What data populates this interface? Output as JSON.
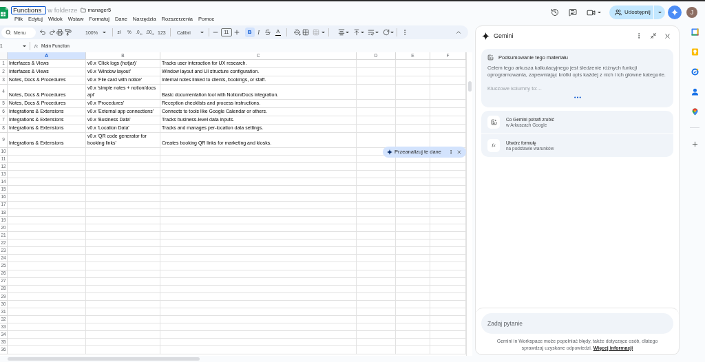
{
  "title_bar": {
    "document_title": "Functions",
    "folder_label": "w folderze",
    "folder_name": "manager5",
    "share_label": "Udostępnij",
    "avatar_initial": "J"
  },
  "menu": [
    "Plik",
    "Edytuj",
    "Widok",
    "Wstaw",
    "Formatuj",
    "Dane",
    "Narzędzia",
    "Rozszerzenia",
    "Pomoc"
  ],
  "toolbar": {
    "search_label": "Menu",
    "zoom": "100%",
    "currency": "zł",
    "percent": "%",
    "decimals_less": ".0",
    "decimals_more": ".00",
    "number_formats": "123",
    "font": "Calibri",
    "font_size": "11",
    "format_buttons": [
      {
        "kind": "bold",
        "label": "B",
        "selected": true
      },
      {
        "kind": "italic",
        "label": "I",
        "selected": false
      },
      {
        "kind": "strikethrough",
        "selected": false
      }
    ],
    "text_color_label": "A"
  },
  "formula_bar": {
    "name_box": "1",
    "function_symbol": "fx",
    "formula": "Main Function"
  },
  "grid": {
    "columns": [
      {
        "label": "A",
        "selected": true
      },
      {
        "label": "B",
        "selected": false
      },
      {
        "label": "C",
        "selected": false
      },
      {
        "label": "D",
        "selected": false
      },
      {
        "label": "E",
        "selected": false
      },
      {
        "label": "F",
        "selected": false
      }
    ],
    "rows": [
      {
        "number": "1",
        "cells": [
          "Interfaces & Views",
          "v0.x 'Click logs (hotjar)'",
          "Tracks user interaction for UX research."
        ]
      },
      {
        "number": "2",
        "cells": [
          "Interfaces & Views",
          "v0.x 'Window layout'",
          "Window layout and UI structure configuration."
        ]
      },
      {
        "number": "3",
        "cells": [
          "Notes, Docs & Procedures",
          "v0.x 'File card with notice'",
          "Internal notes linked to clients, bookings, or staff."
        ]
      },
      {
        "number": "4",
        "cells": [
          "Notes, Docs & Procedures",
          "v0.x 'simple notes + notion/docs api'",
          "Basic documentation tool with Notion/Docs integration."
        ]
      },
      {
        "number": "5",
        "cells": [
          "Notes, Docs & Procedures",
          "v0.x 'Procedures'",
          "Reception checklists and process instructions."
        ]
      },
      {
        "number": "6",
        "cells": [
          "Integrations & Extensions",
          "v0.x 'External app connections'",
          "Connects to tools like Google Calendar or others."
        ]
      },
      {
        "number": "7",
        "cells": [
          "Integrations & Extensions",
          "v0.x 'Business Data'",
          "Tracks business-level data inputs."
        ]
      },
      {
        "number": "8",
        "cells": [
          "Integrations & Extensions",
          "v0.x 'Location Data'",
          "Tracks and manages per-location data settings."
        ]
      },
      {
        "number": "9",
        "cells": [
          "Integrations & Extensions",
          "v0.x 'QR code generator for booking links'",
          "Creates booking QR links for marketing and kiosks."
        ]
      },
      {
        "number": "10"
      },
      {
        "number": "11"
      },
      {
        "number": "12"
      },
      {
        "number": "13"
      },
      {
        "number": "14"
      },
      {
        "number": "15"
      },
      {
        "number": "16"
      },
      {
        "number": "17"
      },
      {
        "number": "18"
      },
      {
        "number": "19"
      },
      {
        "number": "20"
      },
      {
        "number": "21"
      },
      {
        "number": "22"
      },
      {
        "number": "23"
      },
      {
        "number": "24"
      },
      {
        "number": "25"
      },
      {
        "number": "26"
      },
      {
        "number": "27"
      },
      {
        "number": "28"
      },
      {
        "number": "29"
      },
      {
        "number": "30"
      },
      {
        "number": "31"
      },
      {
        "number": "32"
      },
      {
        "number": "33"
      },
      {
        "number": "34"
      },
      {
        "number": "35"
      },
      {
        "number": "36"
      }
    ]
  },
  "analyze_chip": {
    "label": "Przeanalizuj te dane"
  },
  "gemini_panel": {
    "title": "Gemini",
    "summary": {
      "title": "Podsumowanie tego materiału",
      "text": "Celem tego arkusza kalkulacyjnego jest śledzenie różnych funkcji oprogramowania, zapewniając krótki opis każdej z nich i ich główne kategorie.",
      "faded_text": "Kluczowe kolumny to:..."
    },
    "suggestions": [
      {
        "kind": "capabilities",
        "title": "Co Gemini potrafi zrobić",
        "subtitle": "w Arkuszach Google"
      },
      {
        "kind": "formula",
        "symbol": "fx",
        "title": "Utwórz formułę",
        "subtitle": "na podstawie warunków"
      }
    ],
    "input": {
      "placeholder": "Zadaj pytanie"
    },
    "disclaimer": "Gemini in Workspace może popełniać błędy, także dotyczące osób, dlatego sprawdzaj uzyskane odpowiedzi.",
    "disclaimer_link": "Więcej informacji"
  }
}
